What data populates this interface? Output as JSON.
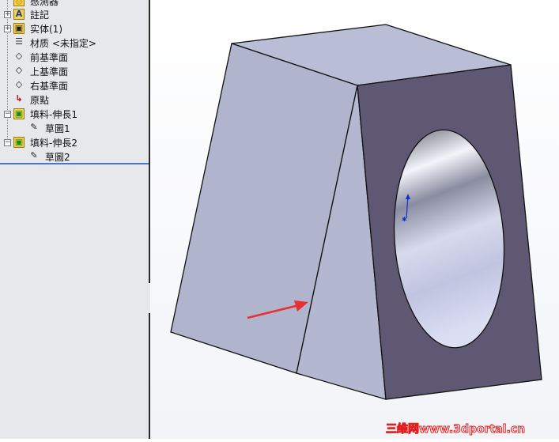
{
  "tree": {
    "items": [
      {
        "label": "感測器",
        "icon": "sensor-icon",
        "expander": ""
      },
      {
        "label": "註記",
        "icon": "annotation-icon",
        "expander": "+"
      },
      {
        "label": "实体(1)",
        "icon": "solid-bodies-icon",
        "expander": "+"
      },
      {
        "label": "材质 <未指定>",
        "icon": "material-icon",
        "expander": ""
      },
      {
        "label": "前基準面",
        "icon": "plane-icon",
        "expander": ""
      },
      {
        "label": "上基準面",
        "icon": "plane-icon",
        "expander": ""
      },
      {
        "label": "右基準面",
        "icon": "plane-icon",
        "expander": ""
      },
      {
        "label": "原點",
        "icon": "origin-icon",
        "expander": ""
      },
      {
        "label": "填料-伸長1",
        "icon": "extrude-icon",
        "expander": "−"
      },
      {
        "label": "草圖1",
        "icon": "sketch-icon",
        "expander": ""
      },
      {
        "label": "填料-伸長2",
        "icon": "extrude-icon",
        "expander": "−"
      },
      {
        "label": "草圖2",
        "icon": "sketch-icon",
        "expander": ""
      }
    ]
  },
  "colors": {
    "top_face": "#b9bdd6",
    "left_face": "#b0b4cc",
    "front_face": "#5f5872",
    "arrow": "#e83030",
    "watermark": "#e02020"
  },
  "watermark": "三维网www.3dportal.cn"
}
